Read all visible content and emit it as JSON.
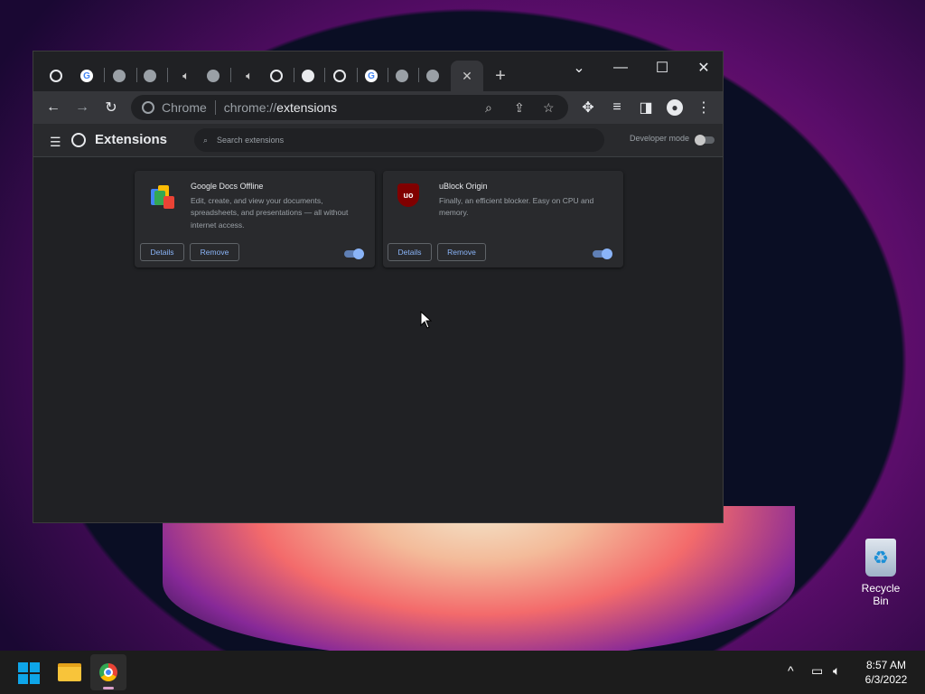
{
  "browser": {
    "omnibox": {
      "site_chip": "Chrome",
      "url_scheme": "chrome://",
      "url_path": "extensions"
    },
    "window_controls": {
      "dropdown": "⌄",
      "minimize": "—",
      "maximize": "☐",
      "close": "✕"
    }
  },
  "page": {
    "title": "Extensions",
    "search_placeholder": "Search extensions",
    "developer_mode_label": "Developer mode",
    "developer_mode_on": false
  },
  "extensions": [
    {
      "name": "Google Docs Offline",
      "description": "Edit, create, and view your documents, spreadsheets, and presentations — all without internet access.",
      "details_label": "Details",
      "remove_label": "Remove",
      "enabled": true
    },
    {
      "name": "uBlock Origin",
      "description": "Finally, an efficient blocker. Easy on CPU and memory.",
      "details_label": "Details",
      "remove_label": "Remove",
      "enabled": true
    }
  ],
  "desktop": {
    "recycle_bin_label": "Recycle Bin"
  },
  "taskbar": {
    "time": "8:57 AM",
    "date": "6/3/2022"
  },
  "colors": {
    "accent": "#8ab4f8",
    "toggle_on": "#8ab4f8",
    "dark_bg": "#202124"
  }
}
